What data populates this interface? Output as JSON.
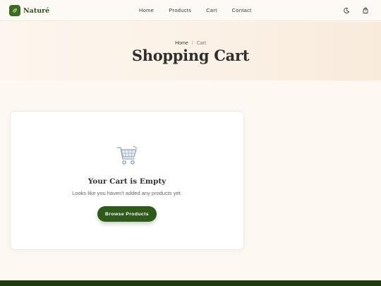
{
  "brand": {
    "name": "Naturé",
    "icon": "leaf-icon",
    "color": "#3d6b22"
  },
  "nav": {
    "links": [
      "Home",
      "Products",
      "Cart",
      "Contact"
    ],
    "theme_toggle_icon": "moon-icon",
    "cart_icon": "shopping-bag-icon"
  },
  "breadcrumb": {
    "home": "Home",
    "separator": "/",
    "current": "Cart"
  },
  "page": {
    "title": "Shopping Cart"
  },
  "cart": {
    "empty_icon": "shopping-cart-icon",
    "empty_title": "Your Cart is Empty",
    "empty_text": "Looks like you haven't added any products yet.",
    "browse_button": "Browse Products"
  },
  "colors": {
    "accent": "#2f5a1b",
    "background": "#fdf8f2",
    "footer": "#1f3a10"
  }
}
